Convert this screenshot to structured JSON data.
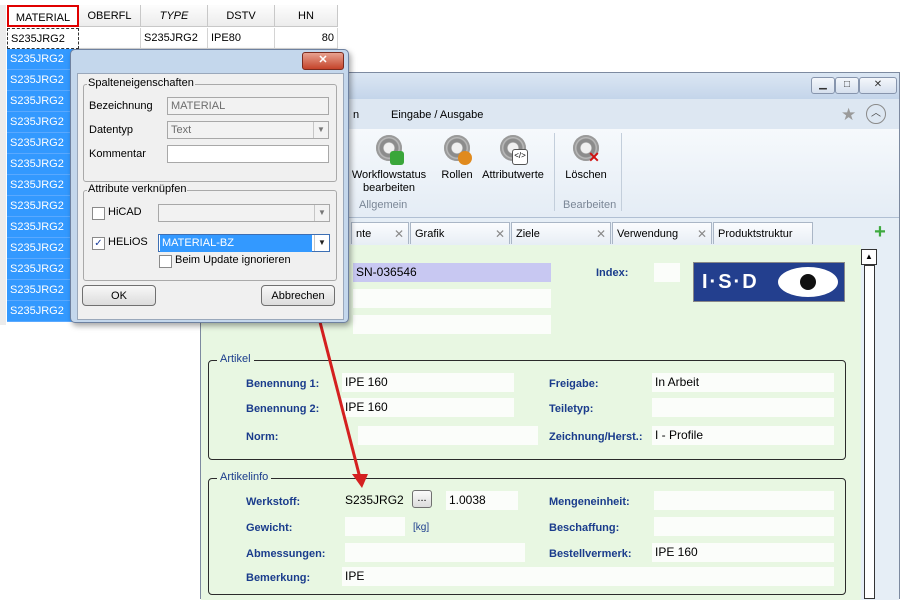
{
  "sheet": {
    "headers": [
      "MATERIAL",
      "OBERFL",
      "TYPE",
      "DSTV",
      "HN"
    ],
    "first_row": {
      "material": "S235JRG2",
      "oberfl": "",
      "type": "S235JRG2",
      "dstv": "IPE80",
      "hn": "80"
    },
    "material_values": [
      "S235JRG2",
      "S235JRG2",
      "S235JRG2",
      "S235JRG2",
      "S235JRG2",
      "S235JRG2",
      "S235JRG2",
      "S235JRG2",
      "S235JRG2",
      "S235JRG2",
      "S235JRG2",
      "S235JRG2",
      "S235JRG2",
      "S235JRG2"
    ]
  },
  "dialog": {
    "close_label": "✕",
    "group1_title": "Spalteneigenschaften",
    "bezeichnung_label": "Bezeichnung",
    "bezeichnung_value": "MATERIAL",
    "datentyp_label": "Datentyp",
    "datentyp_value": "Text",
    "kommentar_label": "Kommentar",
    "kommentar_value": "",
    "group2_title": "Attribute verknüpfen",
    "hicad_label": "HiCAD",
    "hicad_checked": false,
    "hicad_value": "",
    "helios_label": "HELiOS",
    "helios_checked": true,
    "helios_value": "MATERIAL-BZ",
    "update_ignore_label": "Beim Update ignorieren",
    "update_ignore_checked": false,
    "ok_label": "OK",
    "cancel_label": "Abbrechen"
  },
  "window": {
    "ribbon_tab_partial": "n",
    "ribbon_tab_io": "Eingabe / Ausgabe",
    "buttons": {
      "workflow": "Workflowstatus bearbeiten",
      "rollen": "Rollen",
      "attributwerte": "Attributwerte",
      "loeschen": "Löschen"
    },
    "groups": {
      "allgemein": "Allgemein",
      "bearbeiten": "Bearbeiten"
    },
    "doc_tabs": [
      "nte",
      "Grafik",
      "Ziele",
      "Verwendung",
      "Produktstruktur"
    ],
    "header": {
      "number_value": "SN-036546",
      "index_label": "Index:",
      "index_value": "",
      "logo_text": "I·S·D"
    },
    "artikel": {
      "title": "Artikel",
      "benennung1_label": "Benennung 1:",
      "benennung1_value": "IPE 160",
      "benennung2_label": "Benennung 2:",
      "benennung2_value": "IPE 160",
      "norm_label": "Norm:",
      "norm_value": "",
      "freigabe_label": "Freigabe:",
      "freigabe_value": "In Arbeit",
      "teiletyp_label": "Teiletyp:",
      "teiletyp_value": "",
      "zeichnung_label": "Zeichnung/Herst.:",
      "zeichnung_value": "I - Profile"
    },
    "artikelinfo": {
      "title": "Artikelinfo",
      "werkstoff_label": "Werkstoff:",
      "werkstoff_value": "S235JRG2",
      "werkstoff_btn": "...",
      "werkstoff_nr": "1.0038",
      "gewicht_label": "Gewicht:",
      "gewicht_value": "",
      "gewicht_unit": "[kg]",
      "abmessungen_label": "Abmessungen:",
      "abmessungen_value": "",
      "bemerkung_label": "Bemerkung:",
      "bemerkung_value": "IPE",
      "mengeneinheit_label": "Mengeneinheit:",
      "mengeneinheit_value": "",
      "beschaffung_label": "Beschaffung:",
      "beschaffung_value": "",
      "bestellvermerk_label": "Bestellvermerk:",
      "bestellvermerk_value": "IPE 160"
    }
  },
  "colors": {
    "selection_blue": "#3399ff",
    "form_bg": "#e8f7e2",
    "label_blue": "#1a3c8c",
    "highlight_field": "#c8c8f2",
    "arrow_red": "#d42020"
  }
}
